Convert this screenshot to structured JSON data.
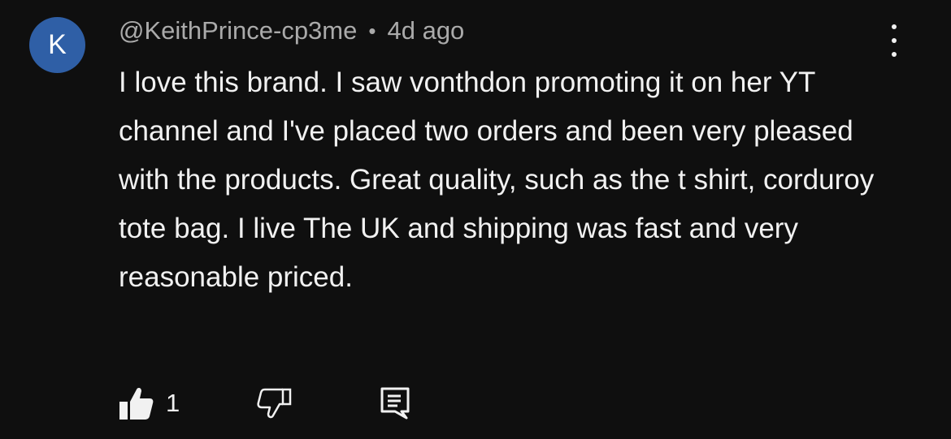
{
  "comment": {
    "avatar_letter": "K",
    "avatar_color": "#2f5fa6",
    "author": "@KeithPrince-cp3me",
    "separator": "•",
    "time": "4d ago",
    "text": "I love this brand. I saw vonthdon promoting it on her YT channel and I've placed two orders and been very pleased with the products. Great quality, such as the t shirt, corduroy tote bag. I live The UK and shipping was fast and very reasonable priced.",
    "like_count": "1"
  },
  "icons": {
    "like": "thumbs-up-icon",
    "dislike": "thumbs-down-icon",
    "reply": "reply-icon",
    "menu": "more-vertical-icon"
  }
}
